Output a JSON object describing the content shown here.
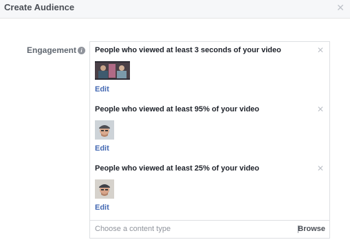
{
  "dialog": {
    "title": "Create Audience",
    "close_icon": "close-icon"
  },
  "engagement": {
    "label": "Engagement",
    "info_icon": "info-icon",
    "info_glyph": "i"
  },
  "rules": [
    {
      "title": "People who viewed at least 3 seconds of your video",
      "edit_label": "Edit",
      "thumbnail": "video-thumbnail-two-people",
      "remove_icon": "close-icon"
    },
    {
      "title": "People who viewed at least 95% of your video",
      "edit_label": "Edit",
      "thumbnail": "video-thumbnail-man-cap",
      "remove_icon": "close-icon"
    },
    {
      "title": "People who viewed at least 25% of your video",
      "edit_label": "Edit",
      "thumbnail": "video-thumbnail-man-cap",
      "remove_icon": "close-icon"
    }
  ],
  "content_type": {
    "placeholder": "Choose a content type",
    "browse_label": "Browse"
  },
  "colors": {
    "link_blue": "#4267b2",
    "header_bg": "#f6f7f9",
    "border": "#dddfe2"
  }
}
